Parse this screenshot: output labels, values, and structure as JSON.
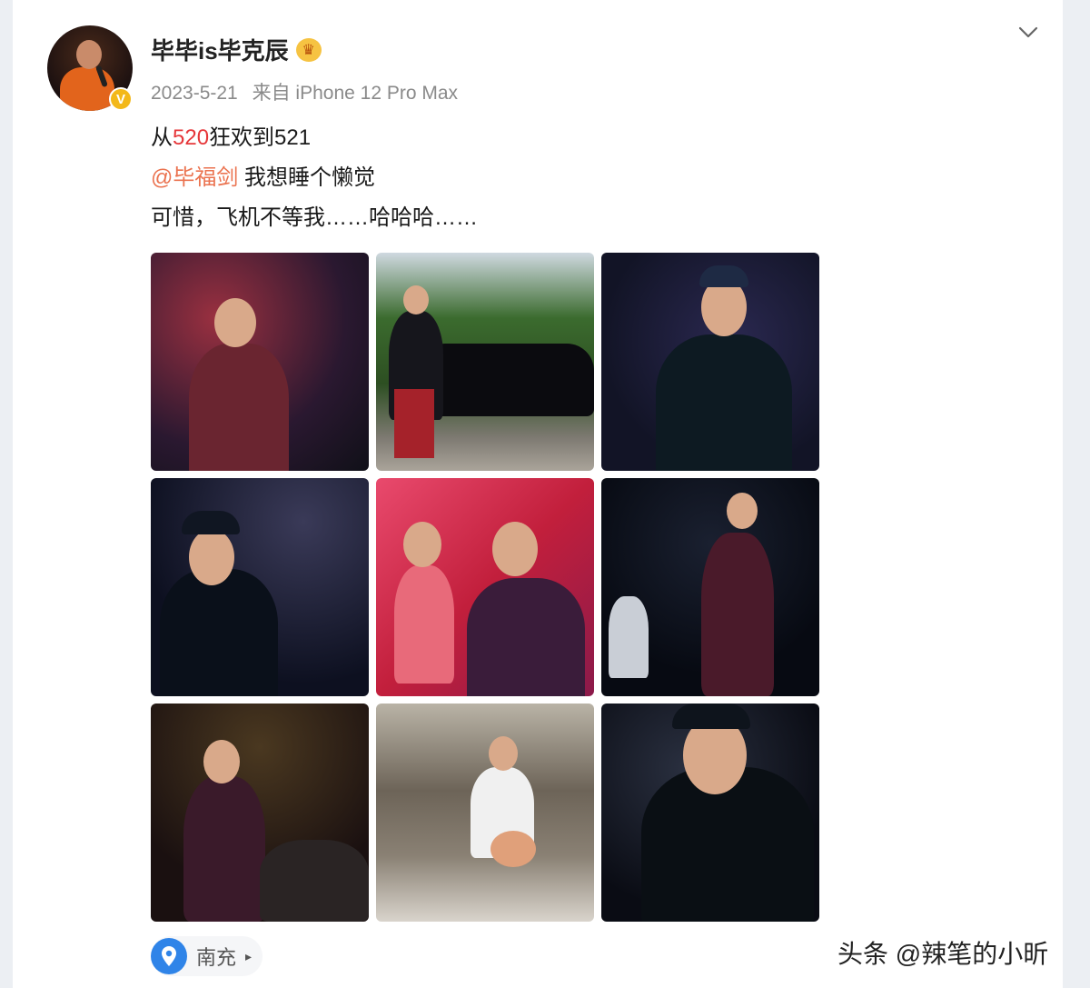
{
  "user": {
    "name": "毕毕is毕克辰",
    "date": "2023-5-21",
    "source": "来自 iPhone 12 Pro Max"
  },
  "post": {
    "line1_prefix": "从",
    "line1_highlight": "520",
    "line1_suffix": "狂欢到521",
    "mention": "@毕福剑",
    "line2_rest": " 我想睡个懒觉",
    "line3": "可惜，飞机不等我……哈哈哈……"
  },
  "location": {
    "label": "南充"
  },
  "watermark": "头条 @辣笔的小昕",
  "colors": {
    "highlight": "#e6373a",
    "mention": "#eb7350",
    "verified": "#f3b81a",
    "location_pin": "#2f84e8"
  },
  "icons": {
    "verified": "verified-icon",
    "crown": "crown-icon",
    "chevron": "chevron-down-icon",
    "location": "location-pin-icon"
  }
}
